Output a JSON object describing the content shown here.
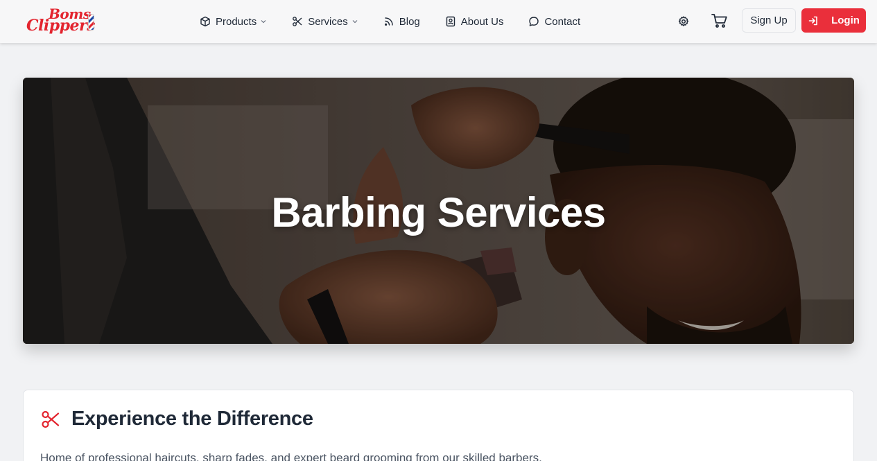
{
  "brand": {
    "line1": "Boms",
    "line2": "Clippers",
    "color": "#e3252f"
  },
  "nav": {
    "items": [
      {
        "label": "Products",
        "icon": "box-icon",
        "dropdown": true
      },
      {
        "label": "Services",
        "icon": "scissors-icon",
        "dropdown": true
      },
      {
        "label": "Blog",
        "icon": "rss-icon",
        "dropdown": false
      },
      {
        "label": "About Us",
        "icon": "contact-book-icon",
        "dropdown": false
      },
      {
        "label": "Contact",
        "icon": "chat-bubble-icon",
        "dropdown": false
      }
    ]
  },
  "actions": {
    "settings_icon": "gear-icon",
    "cart_icon": "cart-icon",
    "signup_label": "Sign Up",
    "login_label": "Login",
    "login_icon": "login-arrow-icon",
    "accent_color": "#ea2f3b"
  },
  "hero": {
    "title": "Barbing Services",
    "image": "barber-cutting-hair-photo"
  },
  "intro": {
    "icon": "scissors-icon",
    "title": "Experience the Difference",
    "text": "Home of professional haircuts, sharp fades, and expert beard grooming from our skilled barbers."
  }
}
